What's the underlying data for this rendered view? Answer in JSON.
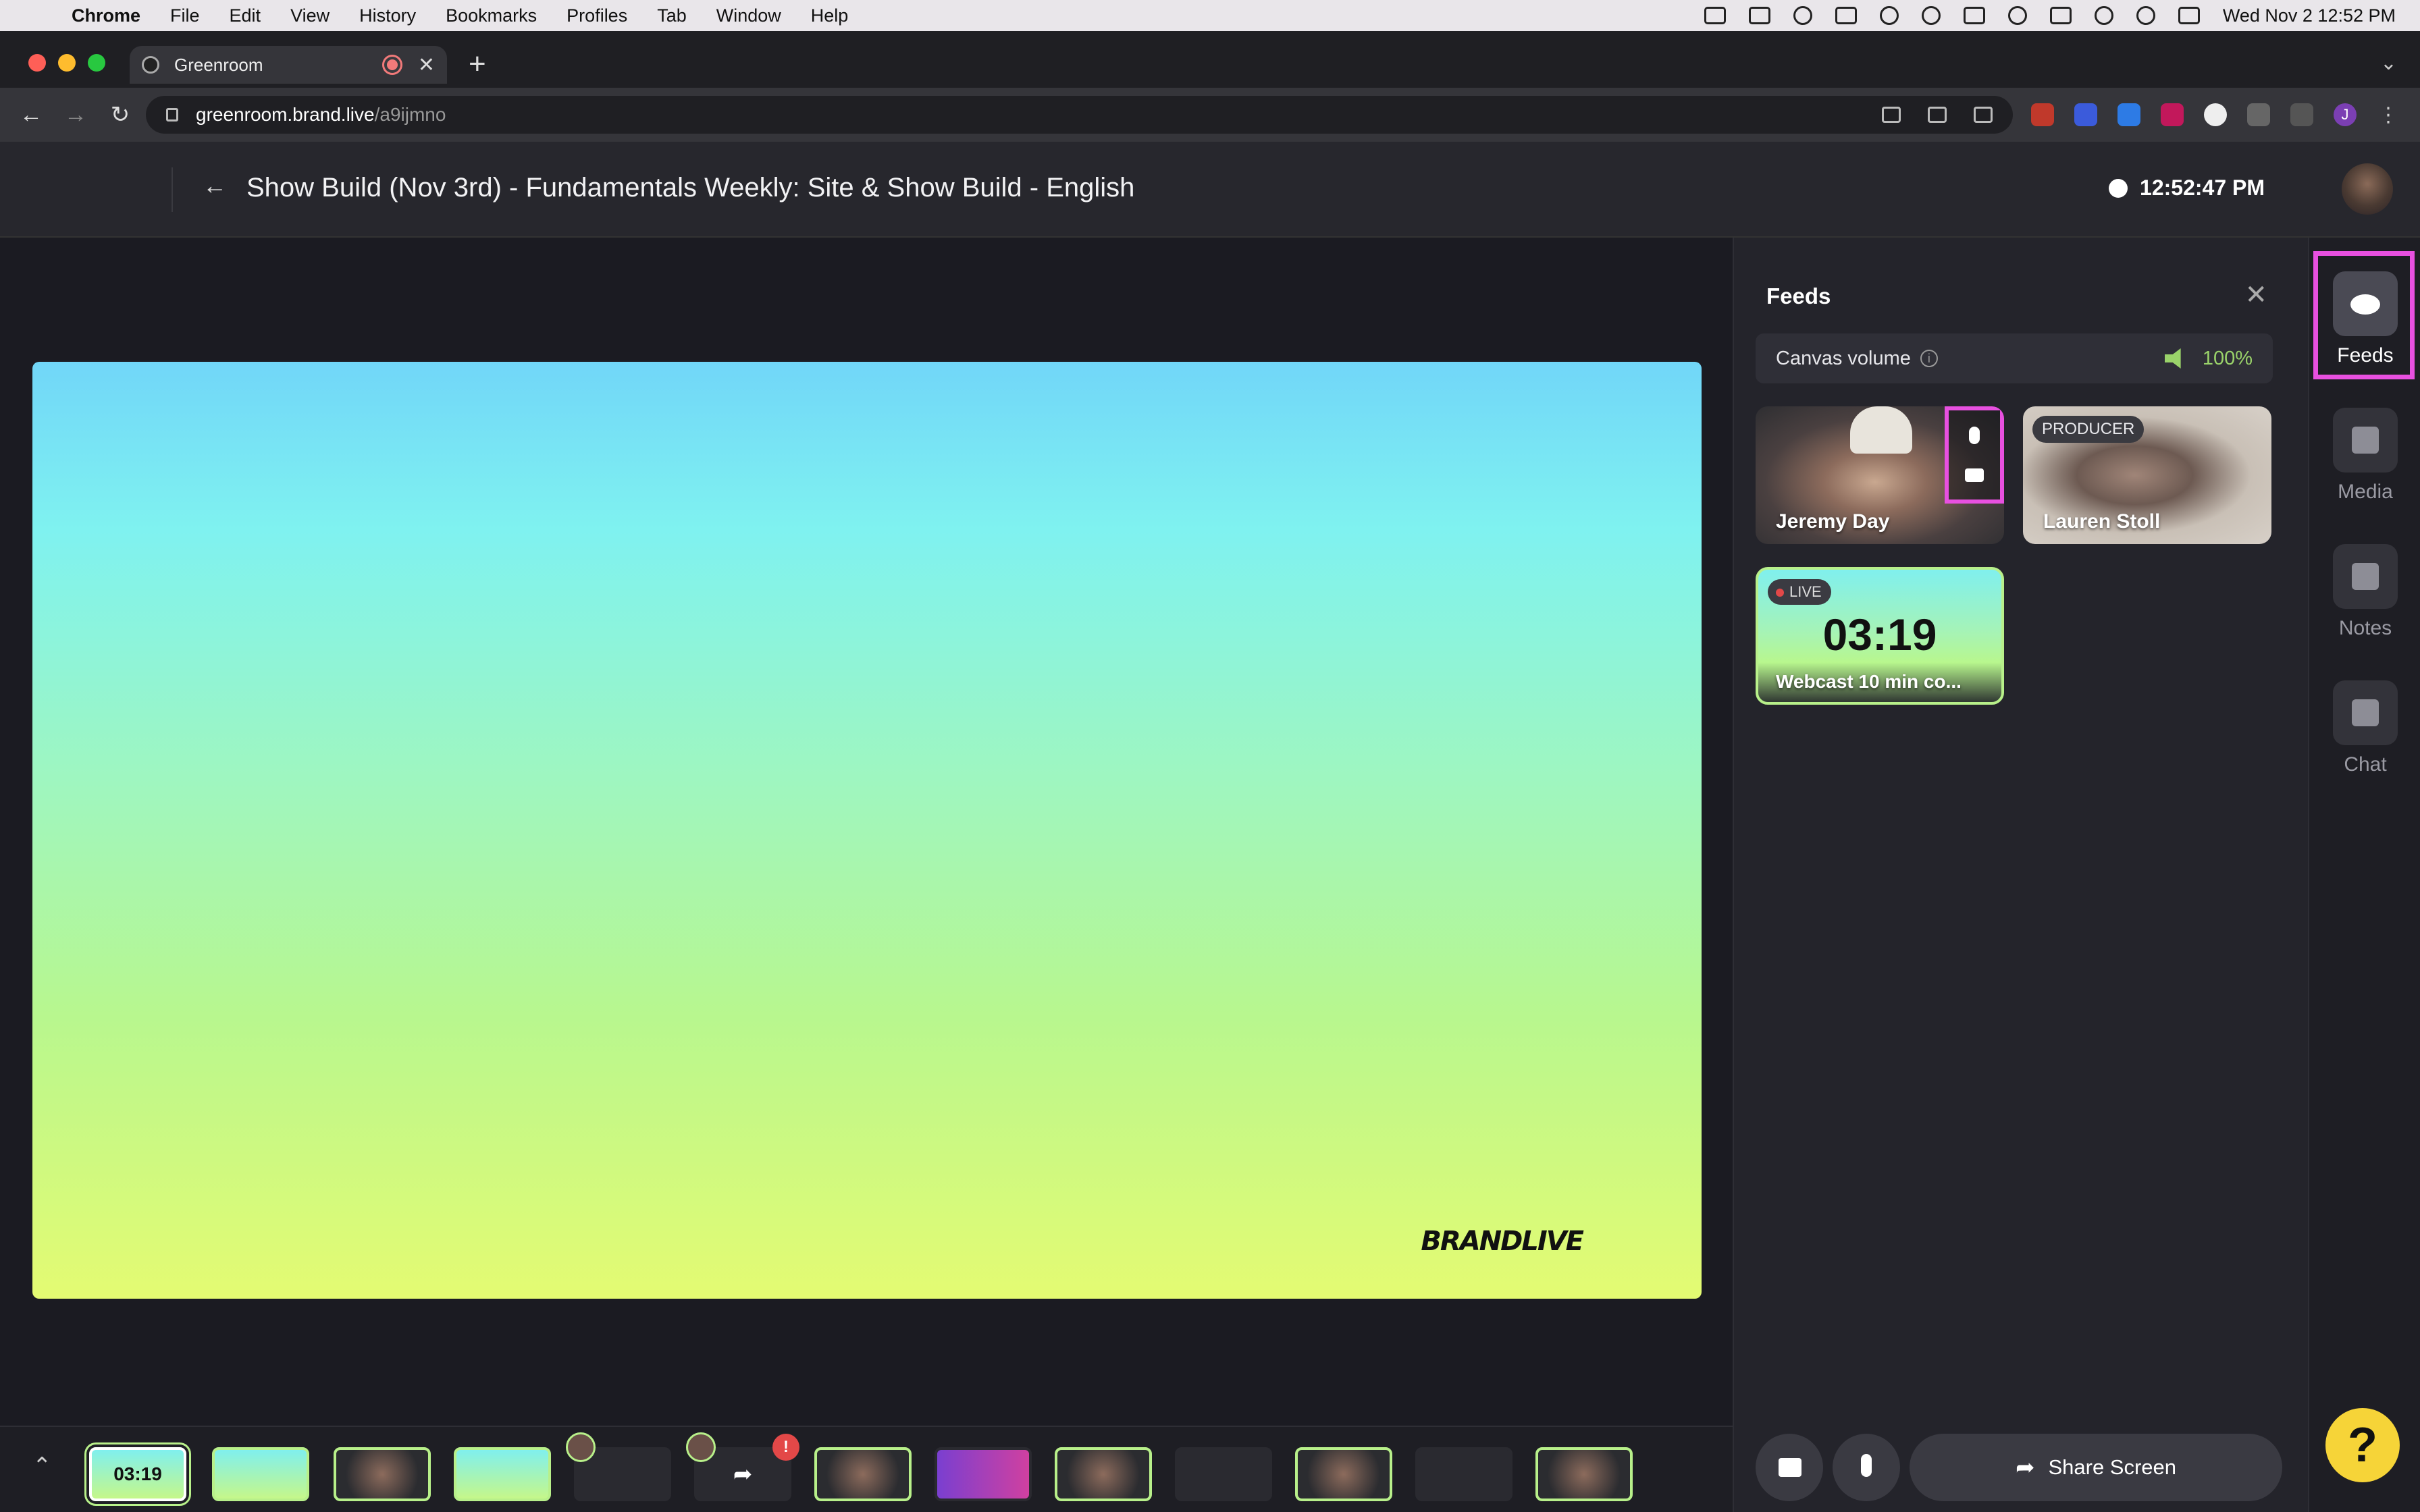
{
  "menubar": {
    "app": "Chrome",
    "items": [
      "File",
      "Edit",
      "View",
      "History",
      "Bookmarks",
      "Profiles",
      "Tab",
      "Window",
      "Help"
    ],
    "datetime": "Wed Nov 2  12:52 PM"
  },
  "browser": {
    "tab_title": "Greenroom",
    "url_host": "greenroom.brand.live",
    "url_path": "/a9ijmno",
    "profile_initial": "J"
  },
  "app": {
    "title": "Show Build (Nov 3rd) - Fundamentals Weekly: Site & Show Build - English",
    "clock": "12:52:47 PM",
    "brand_watermark": "BRANDLIVE"
  },
  "feeds_panel": {
    "heading": "Feeds",
    "canvas_volume_label": "Canvas volume",
    "canvas_volume_value": "100%",
    "feeds": [
      {
        "name": "Jeremy Day"
      },
      {
        "name": "Lauren Stoll",
        "role": "PRODUCER"
      },
      {
        "name": "Webcast 10 min co...",
        "status": "LIVE",
        "timer": "03:19"
      }
    ],
    "share_screen_label": "Share Screen"
  },
  "rail": {
    "items": [
      "Feeds",
      "Media",
      "Notes",
      "Chat"
    ],
    "active": "Feeds"
  },
  "strip": {
    "first_thumb_label": "03:19",
    "alert_badge": "!"
  },
  "help_label": "?",
  "colors": {
    "accent_highlight": "#e850e0",
    "live_green": "#b8f08a",
    "volume_green": "#9ad36a",
    "help_yellow": "#f6d438"
  }
}
